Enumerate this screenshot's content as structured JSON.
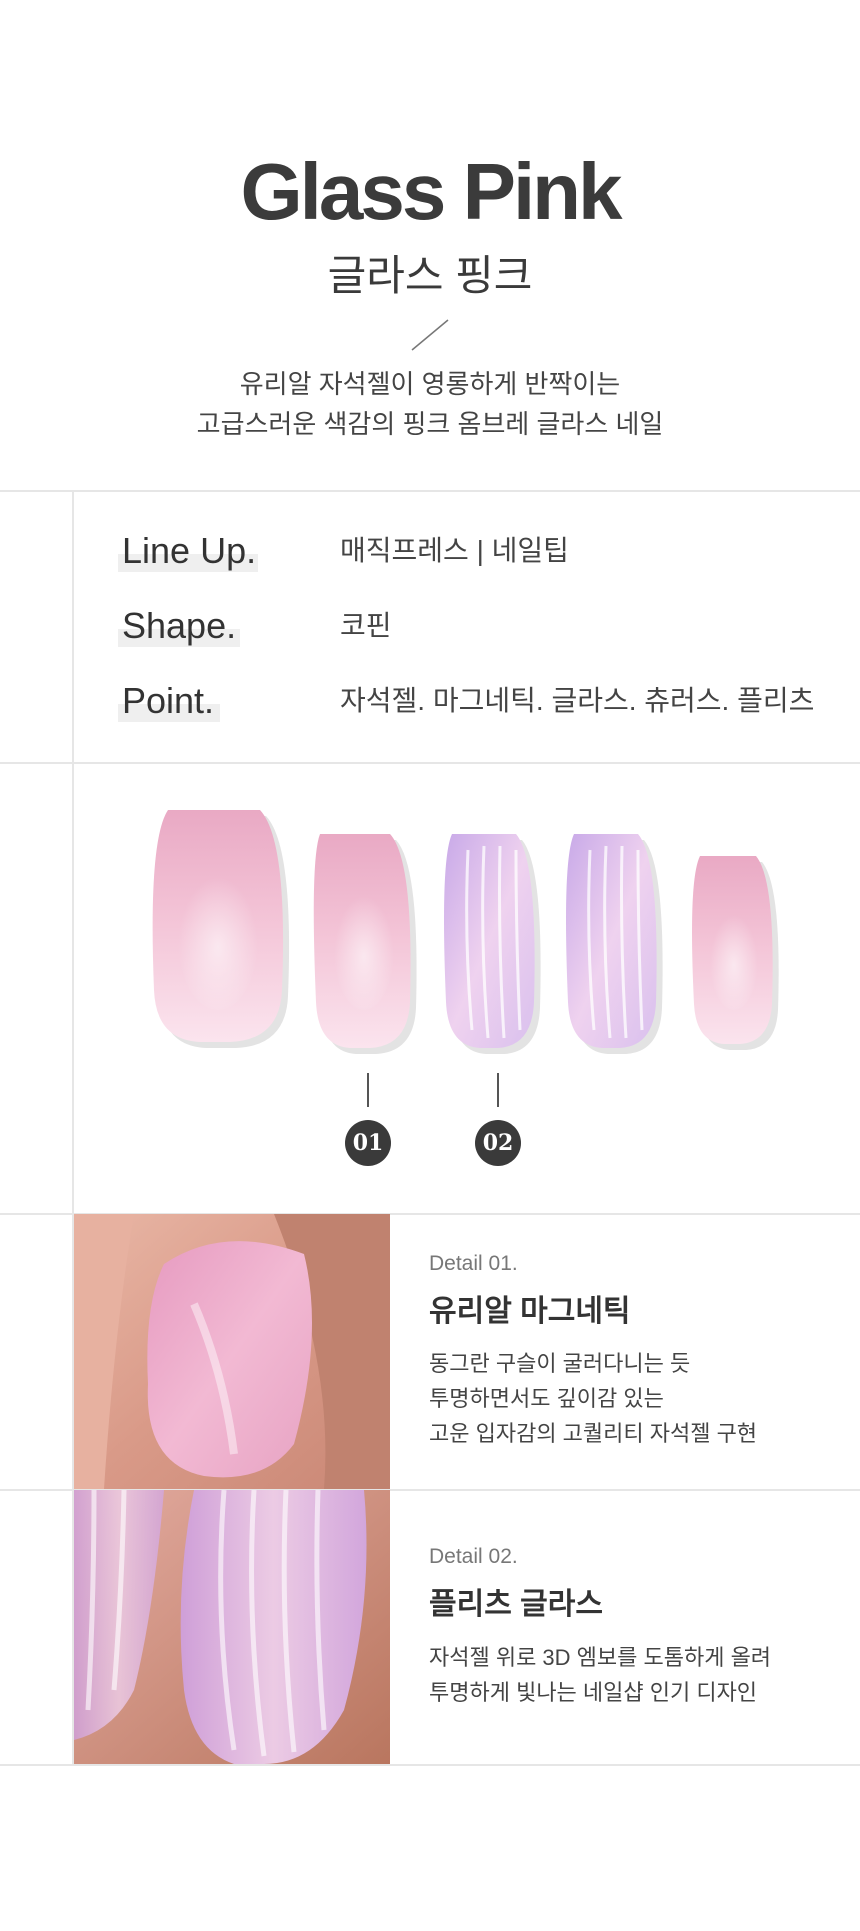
{
  "header": {
    "title": "Glass Pink",
    "subtitle": "글라스 핑크",
    "description_lines": [
      "유리알 자석젤이 영롱하게 반짝이는",
      "고급스러운 색감의 핑크 옴브레 글라스 네일"
    ]
  },
  "specs": [
    {
      "label": "Line Up.",
      "value": "매직프레스 | 네일팁"
    },
    {
      "label": "Shape.",
      "value": "코핀"
    },
    {
      "label": "Point.",
      "value": "자석젤. 마그네틱. 글라스. 츄러스. 플리츠"
    }
  ],
  "markers": [
    "01",
    "02"
  ],
  "details": [
    {
      "tag": "Detail 01.",
      "title": "유리알 마그네틱",
      "lines": [
        "동그란 구슬이 굴러다니는 듯",
        "투명하면서도 깊이감 있는",
        "고운 입자감의 고퀄리티 자석젤 구현"
      ]
    },
    {
      "tag": "Detail 02.",
      "title": "플리츠 글라스",
      "lines": [
        "자석젤 위로 3D 엠보를 도톰하게 올려",
        "투명하게 빛나는 네일샵 인기 디자인"
      ]
    }
  ],
  "colors": {
    "pink_nail": "#f2c6d6",
    "lilac_nail": "#dcc4ee",
    "marker": "#3a3a3a",
    "divider": "#e6e6e6"
  }
}
